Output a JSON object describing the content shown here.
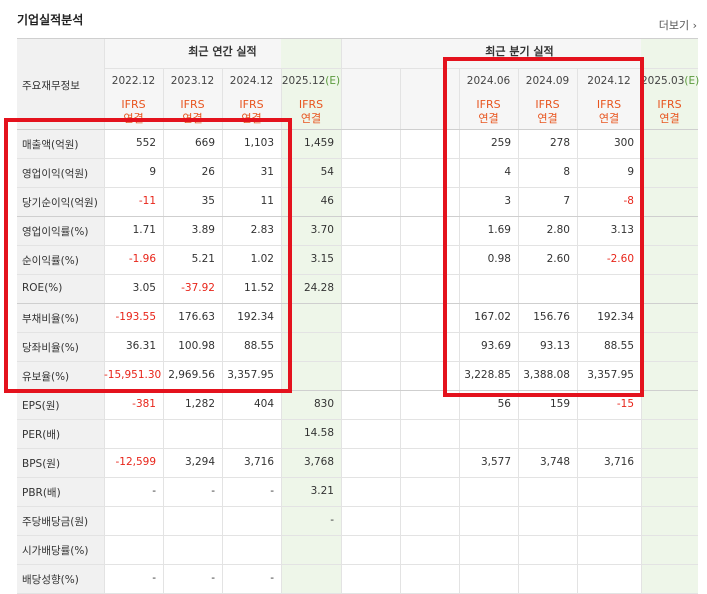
{
  "title": "기업실적분석",
  "more_link": "더보기",
  "header_col_label": "주요재무정보",
  "group_annual": "최근 연간 실적",
  "group_quarter": "최근 분기 실적",
  "periods": [
    "2022.12",
    "2023.12",
    "2024.12",
    "2025.12",
    "",
    "",
    "2024.06",
    "2024.09",
    "2024.12",
    "2025.03"
  ],
  "estimate_mark": "(E)",
  "ifrs_line1": "IFRS",
  "ifrs_line2": "연결",
  "rows": [
    {
      "label": "매출액(억원)",
      "values": [
        "552",
        "669",
        "1,103",
        "1,459",
        "",
        "",
        "259",
        "278",
        "300",
        ""
      ]
    },
    {
      "label": "영업이익(억원)",
      "values": [
        "9",
        "26",
        "31",
        "54",
        "",
        "",
        "4",
        "8",
        "9",
        ""
      ]
    },
    {
      "label": "당기순이익(억원)",
      "values": [
        "-11",
        "35",
        "11",
        "46",
        "",
        "",
        "3",
        "7",
        "-8",
        ""
      ]
    },
    {
      "label": "영업이익률(%)",
      "values": [
        "1.71",
        "3.89",
        "2.83",
        "3.70",
        "",
        "",
        "1.69",
        "2.80",
        "3.13",
        ""
      ]
    },
    {
      "label": "순이익률(%)",
      "values": [
        "-1.96",
        "5.21",
        "1.02",
        "3.15",
        "",
        "",
        "0.98",
        "2.60",
        "-2.60",
        ""
      ]
    },
    {
      "label": "ROE(%)",
      "values": [
        "3.05",
        "-37.92",
        "11.52",
        "24.28",
        "",
        "",
        "",
        "",
        "",
        ""
      ]
    },
    {
      "label": "부채비율(%)",
      "values": [
        "-193.55",
        "176.63",
        "192.34",
        "",
        "",
        "",
        "167.02",
        "156.76",
        "192.34",
        ""
      ]
    },
    {
      "label": "당좌비율(%)",
      "values": [
        "36.31",
        "100.98",
        "88.55",
        "",
        "",
        "",
        "93.69",
        "93.13",
        "88.55",
        ""
      ]
    },
    {
      "label": "유보율(%)",
      "values": [
        "-15,951.30",
        "2,969.56",
        "3,357.95",
        "",
        "",
        "",
        "3,228.85",
        "3,388.08",
        "3,357.95",
        ""
      ]
    },
    {
      "label": "EPS(원)",
      "values": [
        "-381",
        "1,282",
        "404",
        "830",
        "",
        "",
        "56",
        "159",
        "-15",
        ""
      ]
    },
    {
      "label": "PER(배)",
      "values": [
        "",
        "",
        "",
        "14.58",
        "",
        "",
        "",
        "",
        "",
        ""
      ]
    },
    {
      "label": "BPS(원)",
      "values": [
        "-12,599",
        "3,294",
        "3,716",
        "3,768",
        "",
        "",
        "3,577",
        "3,748",
        "3,716",
        ""
      ]
    },
    {
      "label": "PBR(배)",
      "values": [
        "-",
        "-",
        "-",
        "3.21",
        "",
        "",
        "",
        "",
        "",
        ""
      ]
    },
    {
      "label": "주당배당금(원)",
      "values": [
        "",
        "",
        "",
        "-",
        "",
        "",
        "",
        "",
        "",
        ""
      ]
    },
    {
      "label": "시가배당률(%)",
      "values": [
        "",
        "",
        "",
        "",
        "",
        "",
        "",
        "",
        "",
        ""
      ]
    },
    {
      "label": "배당성향(%)",
      "values": [
        "-",
        "-",
        "-",
        "",
        "",
        "",
        "",
        "",
        "",
        ""
      ]
    }
  ],
  "colors": {
    "negative": "#e8251a",
    "ifrs": "#e8551f",
    "estimate_bg": "#eef6e9",
    "highlight": "#e4121d"
  }
}
